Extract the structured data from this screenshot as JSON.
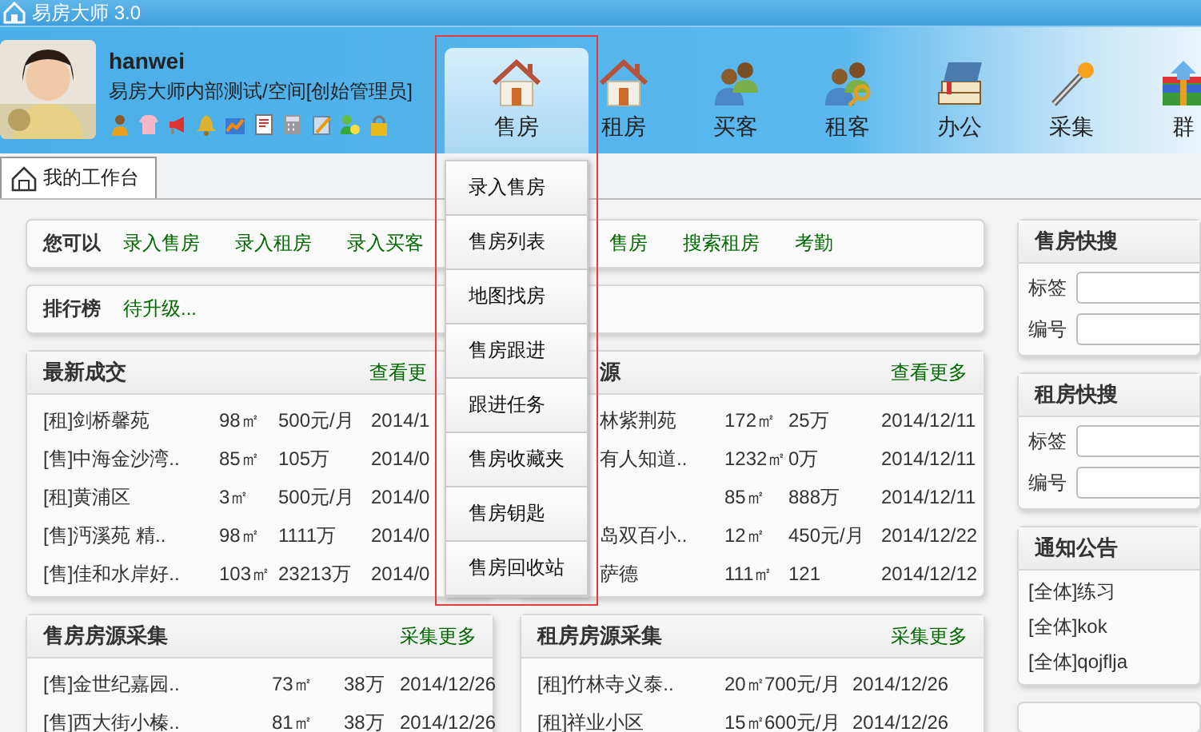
{
  "window": {
    "title": "易房大师 3.0"
  },
  "user": {
    "name": "hanwei",
    "org": "易房大师内部测试/空间[创始管理员]"
  },
  "nav": [
    {
      "label": "售房",
      "kind": "house",
      "selected": true
    },
    {
      "label": "租房",
      "kind": "house",
      "selected": false
    },
    {
      "label": "买客",
      "kind": "people",
      "selected": false
    },
    {
      "label": "租客",
      "kind": "peoplekey",
      "selected": false
    },
    {
      "label": "办公",
      "kind": "books",
      "selected": false
    },
    {
      "label": "采集",
      "kind": "wand",
      "selected": false
    },
    {
      "label": "群",
      "kind": "box",
      "selected": false
    }
  ],
  "tabs": [
    {
      "label": "我的工作台",
      "selected": true
    }
  ],
  "dropdown": [
    "录入售房",
    "售房列表",
    "地图找房",
    "售房跟进",
    "跟进任务",
    "售房收藏夹",
    "售房钥匙",
    "售房回收站"
  ],
  "quick_actions": {
    "label": "您可以",
    "links": [
      "录入售房",
      "录入租房",
      "录入买客",
      "售房",
      "搜索租房",
      "考勤"
    ]
  },
  "ranking": {
    "label": "排行榜",
    "value": "待升级..."
  },
  "tables": [
    {
      "title": "最新成交",
      "more": "查看更",
      "rows": [
        [
          "[租]剑桥馨苑",
          "98㎡",
          "500元/月",
          "2014/1"
        ],
        [
          "[售]中海金沙湾..",
          "85㎡",
          "105万",
          "2014/0"
        ],
        [
          "[租]黄浦区",
          "3㎡",
          "500元/月",
          "2014/0"
        ],
        [
          "[售]沔溪苑 精..",
          "98㎡",
          "1111万",
          "2014/0"
        ],
        [
          "[售]佳和水岸好..",
          "103㎡",
          "23213万",
          "2014/0"
        ]
      ]
    },
    {
      "title": "源",
      "more": "查看更多",
      "rows": [
        [
          "林紫荆苑",
          "172㎡",
          "25万",
          "2014/12/11"
        ],
        [
          "有人知道..",
          "1232㎡",
          "0万",
          "2014/12/11"
        ],
        [
          "",
          "85㎡",
          "888万",
          "2014/12/11"
        ],
        [
          "岛双百小..",
          "12㎡",
          "450元/月",
          "2014/12/22"
        ],
        [
          "萨德",
          "111㎡",
          "121",
          "2014/12/12"
        ]
      ]
    },
    {
      "title": "售房房源采集",
      "more": "采集更多",
      "rows": [
        [
          "[售]金世纪嘉园..",
          "73㎡",
          "38万",
          "2014/12/26"
        ],
        [
          "[售]西大街小榛..",
          "81㎡",
          "38万",
          "2014/12/26"
        ]
      ]
    },
    {
      "title": "租房房源采集",
      "more": "采集更多",
      "rows": [
        [
          "[租]竹林寺义泰..",
          "20㎡",
          "700元/月",
          "2014/12/26"
        ],
        [
          "[租]祥业小区",
          "15㎡",
          "600元/月",
          "2014/12/26"
        ]
      ]
    }
  ],
  "sale_search": {
    "title": "售房快搜",
    "fields": [
      "标签",
      "编号"
    ]
  },
  "rent_search": {
    "title": "租房快搜",
    "fields": [
      "标签",
      "编号"
    ]
  },
  "notices": {
    "title": "通知公告",
    "items": [
      "[全体]练习",
      "[全体]kok",
      "[全体]qojflja"
    ]
  }
}
